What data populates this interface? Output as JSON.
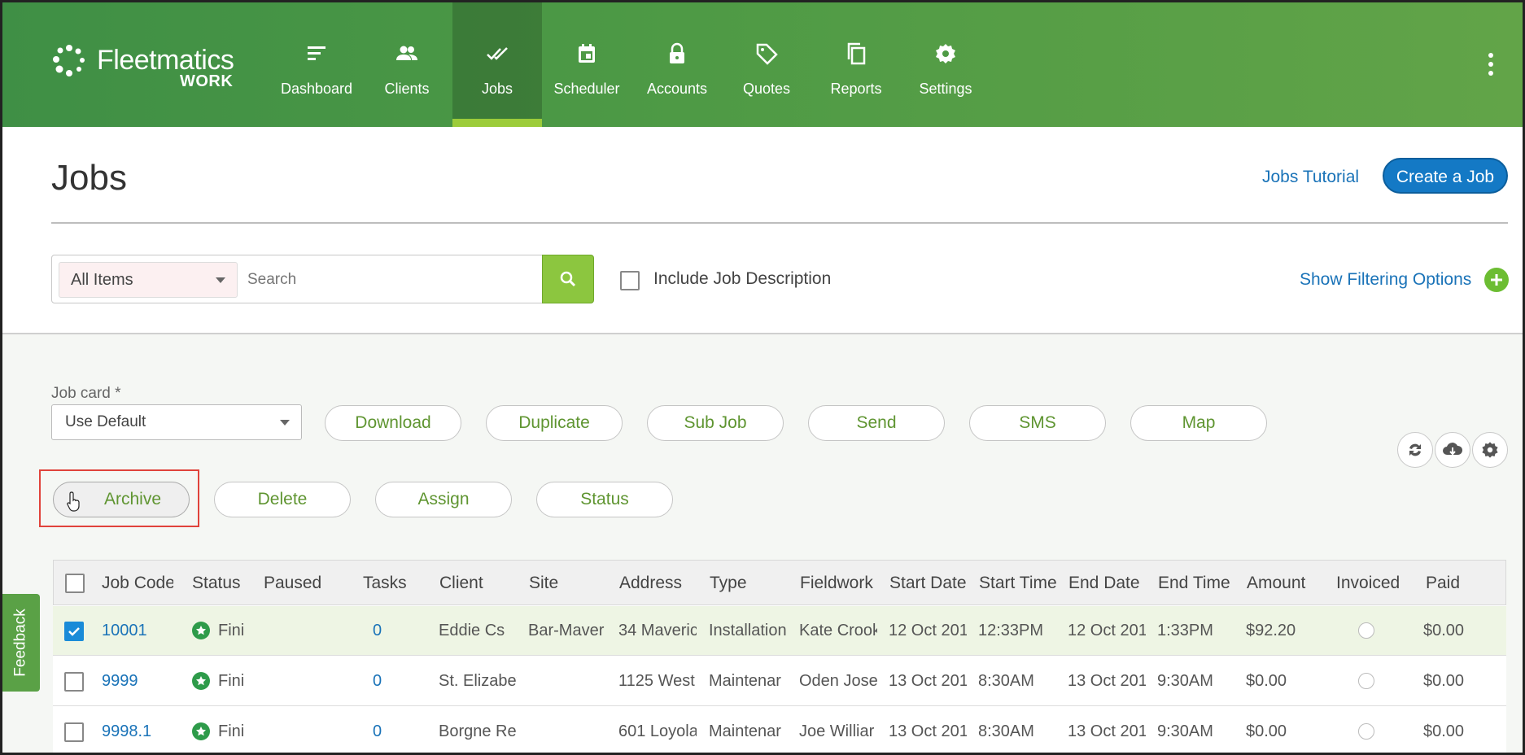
{
  "brand": {
    "name": "Fleetmatics",
    "sub": "WORK"
  },
  "nav": {
    "items": [
      {
        "label": "Dashboard",
        "icon": "dashboard-icon"
      },
      {
        "label": "Clients",
        "icon": "clients-icon"
      },
      {
        "label": "Jobs",
        "icon": "jobs-icon",
        "active": true
      },
      {
        "label": "Scheduler",
        "icon": "calendar-icon"
      },
      {
        "label": "Accounts",
        "icon": "lock-icon"
      },
      {
        "label": "Quotes",
        "icon": "tag-icon"
      },
      {
        "label": "Reports",
        "icon": "copy-icon"
      },
      {
        "label": "Settings",
        "icon": "gear-icon"
      }
    ]
  },
  "header": {
    "title": "Jobs",
    "tutorial_link": "Jobs Tutorial",
    "create_button": "Create a Job"
  },
  "search": {
    "scope": "All Items",
    "placeholder": "Search",
    "include_description": "Include Job Description",
    "filter_link": "Show Filtering Options"
  },
  "actions": {
    "jobcard_label": "Job card *",
    "jobcard_value": "Use Default",
    "row1": [
      "Download",
      "Duplicate",
      "Sub Job",
      "Send",
      "SMS",
      "Map"
    ],
    "row2": [
      "Archive",
      "Delete",
      "Assign",
      "Status"
    ]
  },
  "table": {
    "columns": [
      "Job Code",
      "Status",
      "Paused",
      "Tasks",
      "Client",
      "Site",
      "Address",
      "Type",
      "Fieldwork",
      "Start Date",
      "Start Time",
      "End Date",
      "End Time",
      "Amount",
      "Invoiced",
      "Paid"
    ],
    "rows": [
      {
        "checked": true,
        "code": "10001",
        "status": "Fini",
        "paused": "",
        "tasks": "0",
        "client": "Eddie Cs",
        "site": "Bar-Maver",
        "address": "34 Maveric",
        "type": "Installation",
        "fieldwork": "Kate Crook",
        "start_date": "12 Oct 201",
        "start_time": "12:33PM",
        "end_date": "12 Oct 201",
        "end_time": "1:33PM",
        "amount": "$92.20",
        "paid": "$0.00"
      },
      {
        "checked": false,
        "code": "9999",
        "status": "Fini",
        "paused": "",
        "tasks": "0",
        "client": "St. Elizabet",
        "site": "",
        "address": "1125 West",
        "type": "Maintenar",
        "fieldwork": "Oden Jose",
        "start_date": "13 Oct 201",
        "start_time": "8:30AM",
        "end_date": "13 Oct 201",
        "end_time": "9:30AM",
        "amount": "$0.00",
        "paid": "$0.00"
      },
      {
        "checked": false,
        "code": "9998.1",
        "status": "Fini",
        "paused": "",
        "tasks": "0",
        "client": "Borgne Re",
        "site": "",
        "address": "601 Loyola",
        "type": "Maintenar",
        "fieldwork": "Joe Williar",
        "start_date": "13 Oct 201",
        "start_time": "8:30AM",
        "end_date": "13 Oct 201",
        "end_time": "9:30AM",
        "amount": "$0.00",
        "paid": "$0.00"
      }
    ]
  },
  "feedback": "Feedback",
  "colors": {
    "nav_green": "#4e9a45",
    "accent_lime": "#8cc63f",
    "link_blue": "#1a73b8",
    "create_blue": "#1479c5",
    "highlight_red": "#e0433b"
  }
}
